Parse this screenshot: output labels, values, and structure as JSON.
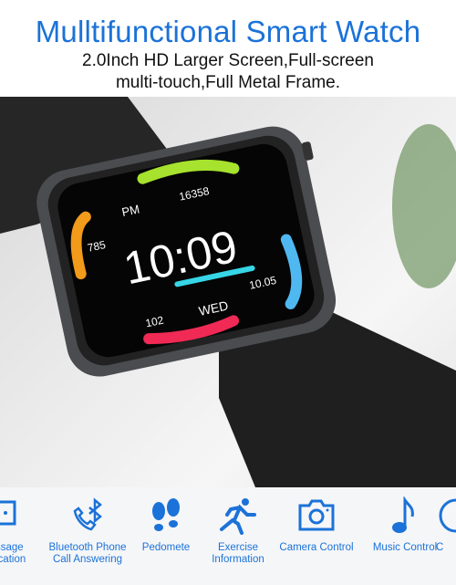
{
  "header": {
    "title": "Mulltifunctional Smart Watch",
    "subtitle_line1": "2.0Inch HD Larger Screen,Full-screen",
    "subtitle_line2": "multi-touch,Full Metal Frame."
  },
  "watch_screen": {
    "period": "PM",
    "steps": "16358",
    "calories": "785",
    "time": "10:09",
    "date": "10.05",
    "heart_rate": "102",
    "weekday": "WED"
  },
  "features": [
    {
      "label": "ssage\nication",
      "icon": "message-icon"
    },
    {
      "label": "Bluetooth Phone\nCall Answering",
      "icon": "bluetooth-phone-icon"
    },
    {
      "label": "Pedomete",
      "icon": "footprints-icon"
    },
    {
      "label": "Exercise\nInformation",
      "icon": "running-icon"
    },
    {
      "label": "Camera Control",
      "icon": "camera-icon"
    },
    {
      "label": "Music Control",
      "icon": "music-note-icon"
    },
    {
      "label": "C",
      "icon": "clock-icon"
    }
  ],
  "colors": {
    "accent": "#1b72d8"
  }
}
